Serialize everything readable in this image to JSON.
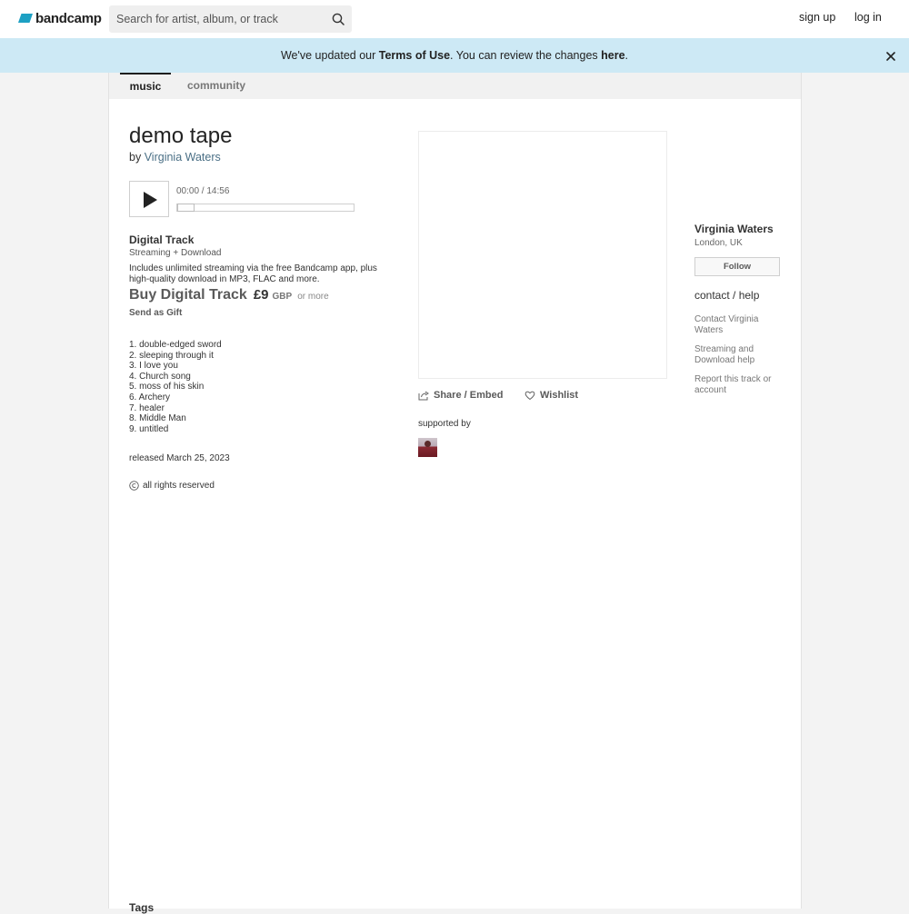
{
  "header": {
    "logo_text": "bandcamp",
    "search_placeholder": "Search for artist, album, or track",
    "signup": "sign up",
    "login": "log in"
  },
  "notice": {
    "prefix": "We've updated our ",
    "terms": "Terms of Use",
    "middle": ". You can review the changes ",
    "here": "here",
    "suffix": "."
  },
  "tabs": [
    {
      "label": "music"
    },
    {
      "label": "community"
    }
  ],
  "album": {
    "title": "demo tape",
    "by": "by",
    "artist": "Virginia Waters"
  },
  "player": {
    "time": "00:00 / 14:56",
    "progress": 0
  },
  "purchase": {
    "format_title": "Digital Track",
    "format_subtitle": "Streaming + Download",
    "description": "Includes unlimited streaming via the free Bandcamp app, plus high-quality download in MP3, FLAC and more.",
    "buy_label": "Buy Digital Track",
    "price": "£9",
    "currency": "GBP",
    "or_more": "or more",
    "gift": "Send as Gift"
  },
  "tracks": [
    "1. double-edged sword",
    "2. sleeping through it",
    "3. I love you",
    "4. Church song",
    "5. moss of his skin",
    "6. Archery",
    "7. healer",
    "8. Middle Man",
    "9. untitled"
  ],
  "release": {
    "released": "released March 25, 2023",
    "rights": "all rights reserved"
  },
  "actions": {
    "share": "Share / Embed",
    "wishlist": "Wishlist"
  },
  "supported_by": "supported by",
  "tags_heading": "Tags",
  "band": {
    "name": "Virginia Waters",
    "location": "London, UK",
    "follow": "Follow"
  },
  "help": {
    "title": "contact / help",
    "links": [
      "Contact Virginia Waters",
      "Streaming and Download help",
      "Report this track or account"
    ]
  },
  "colors": {
    "notice_bg": "#cde9f5",
    "logo_accent": "#1da0c3",
    "link": "#4a6f85"
  },
  "icons": [
    "search-icon",
    "close-icon",
    "play-icon",
    "copyright-icon",
    "share-icon",
    "heart-icon"
  ]
}
